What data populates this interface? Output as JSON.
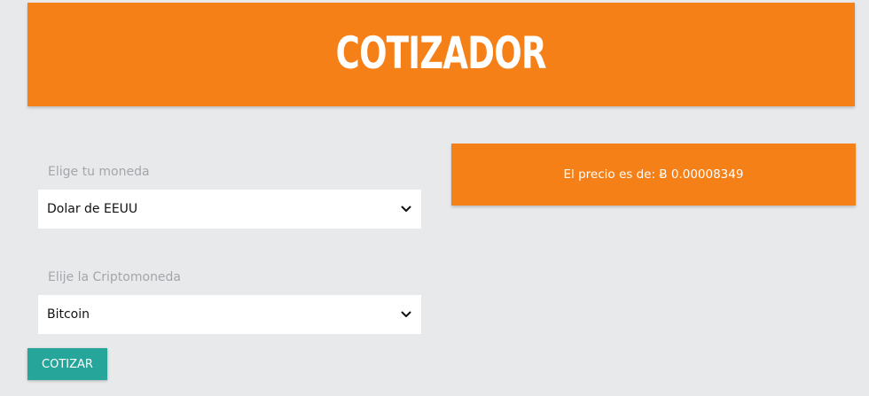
{
  "header": {
    "title": "COTIZADOR"
  },
  "form": {
    "currency_label": "Elige tu moneda",
    "currency_selected": "Dolar de EEUU",
    "crypto_label": "Elije la Criptomoneda",
    "crypto_selected": "Bitcoin",
    "submit_label": "COTIZAR"
  },
  "result": {
    "price_text": "El precio es de: Ƀ 0.00008349"
  },
  "icons": {
    "dropdown": "chevron-down-icon"
  },
  "colors": {
    "accent_orange": "#f58018",
    "button_teal": "#26a69a",
    "background": "#e8e9eb",
    "label_gray": "#a3a6ab"
  }
}
